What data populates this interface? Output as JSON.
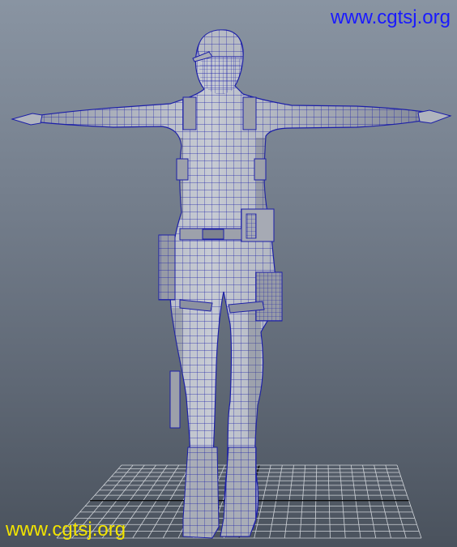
{
  "viewport": {
    "background_top": "#8994a2",
    "background_bottom": "#4a525d",
    "grid_color": "#cfd3d8",
    "grid_axis_color": "#0d0d0d",
    "mesh_fill": "#b4b8c2",
    "mesh_wire_color": "#1c1fa8"
  },
  "watermark_top": {
    "text": "www.cgtsj.org",
    "color": "#1a1aff"
  },
  "watermark_bottom": {
    "text": "www.cgtsj.org",
    "color": "#f2e400"
  }
}
